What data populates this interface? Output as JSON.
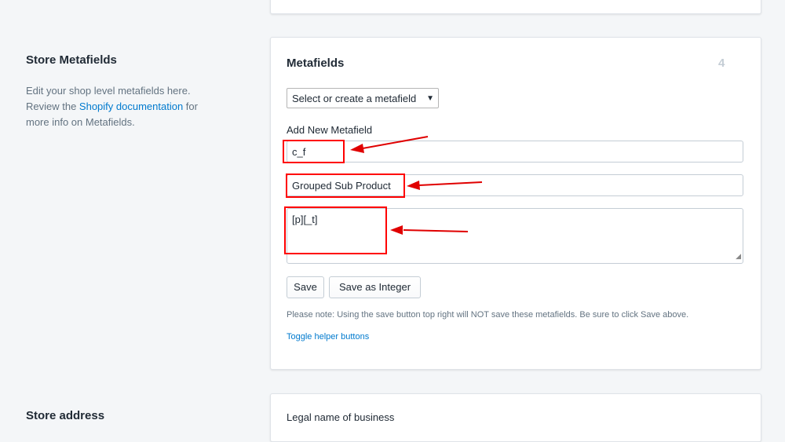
{
  "store_metafields": {
    "title": "Store Metafields",
    "desc_before": "Edit your shop level metafields here. Review the ",
    "desc_link": "Shopify documentation",
    "desc_after": " for more info on Metafields."
  },
  "metafields_card": {
    "title": "Metafields",
    "count": "4",
    "select_value": "Select or create a metafield",
    "add_label": "Add New Metafield",
    "namespace_value": "c_f",
    "key_value": "Grouped Sub Product",
    "value_value": "[p][_t]",
    "save_label": "Save",
    "save_integer_label": "Save as Integer",
    "note": "Please note: Using the save button top right will NOT save these metafields. Be sure to click Save above.",
    "toggle_label": "Toggle helper buttons"
  },
  "store_address": {
    "title": "Store address",
    "legal_name_label": "Legal name of business"
  },
  "colors": {
    "annotation": "#ff0000",
    "link": "#007ace",
    "background": "#f4f6f8"
  }
}
